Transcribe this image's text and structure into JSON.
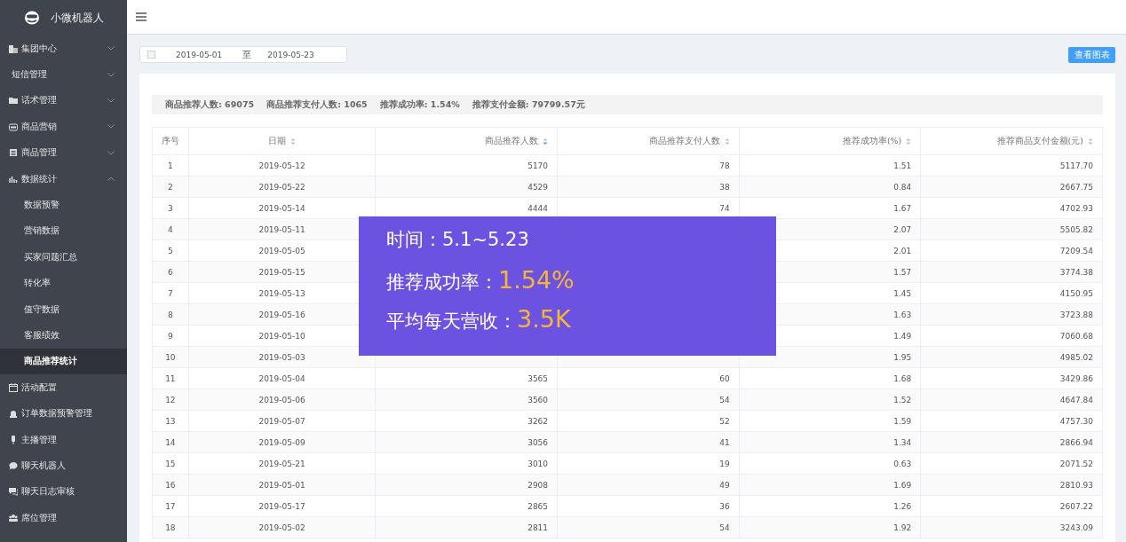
{
  "app": {
    "name": "小微机器人"
  },
  "sidebar": {
    "items": [
      {
        "label": "集团中心",
        "expanded": false
      },
      {
        "label": "短信管理",
        "expanded": false
      },
      {
        "label": "话术管理",
        "expanded": false
      },
      {
        "label": "商品营销",
        "expanded": false
      },
      {
        "label": "商品管理",
        "expanded": false
      },
      {
        "label": "数据统计",
        "expanded": true,
        "children": [
          {
            "label": "数据预警",
            "selected": false
          },
          {
            "label": "营销数据",
            "selected": false
          },
          {
            "label": "买家问题汇总",
            "selected": false
          },
          {
            "label": "转化率",
            "selected": false
          },
          {
            "label": "值守数据",
            "selected": false
          },
          {
            "label": "客服绩效",
            "selected": false
          },
          {
            "label": "商品推荐统计",
            "selected": true
          }
        ]
      },
      {
        "label": "活动配置"
      },
      {
        "label": "订单数据预警管理"
      },
      {
        "label": "主播管理"
      },
      {
        "label": "聊天机器人"
      },
      {
        "label": "聊天日志审核"
      },
      {
        "label": "席位管理"
      }
    ]
  },
  "filter": {
    "start": "2019-05-01",
    "separator": "至",
    "end": "2019-05-23"
  },
  "chart_button": "查看图表",
  "summary": [
    "商品推荐人数: 69075",
    "商品推荐支付人数: 1065",
    "推荐成功率: 1.54%",
    "推荐支付金额: 79799.57元"
  ],
  "table": {
    "columns": [
      {
        "label": "序号",
        "sortable": false
      },
      {
        "label": "日期",
        "sortable": true,
        "sorted": false
      },
      {
        "label": "商品推荐人数",
        "sortable": true,
        "sorted": true
      },
      {
        "label": "商品推荐支付人数",
        "sortable": true,
        "sorted": false
      },
      {
        "label": "推荐成功率(%)",
        "sortable": true,
        "sorted": false
      },
      {
        "label": "推荐商品支付金额(元)",
        "sortable": true,
        "sorted": false
      }
    ],
    "rows": [
      [
        "1",
        "2019-05-12",
        "5170",
        "78",
        "1.51",
        "5117.70"
      ],
      [
        "2",
        "2019-05-22",
        "4529",
        "38",
        "0.84",
        "2667.75"
      ],
      [
        "3",
        "2019-05-14",
        "4444",
        "74",
        "1.67",
        "4702.93"
      ],
      [
        "4",
        "2019-05-11",
        null,
        null,
        "2.07",
        "5505.82"
      ],
      [
        "5",
        "2019-05-05",
        null,
        null,
        "2.01",
        "7209.54"
      ],
      [
        "6",
        "2019-05-15",
        null,
        null,
        "1.57",
        "3774.38"
      ],
      [
        "7",
        "2019-05-13",
        null,
        null,
        "1.45",
        "4150.95"
      ],
      [
        "8",
        "2019-05-16",
        null,
        null,
        "1.63",
        "3723.88"
      ],
      [
        "9",
        "2019-05-10",
        null,
        null,
        "1.49",
        "7060.68"
      ],
      [
        "10",
        "2019-05-03",
        null,
        null,
        "1.95",
        "4985.02"
      ],
      [
        "11",
        "2019-05-04",
        "3565",
        "60",
        "1.68",
        "3429.86"
      ],
      [
        "12",
        "2019-05-06",
        "3560",
        "54",
        "1.52",
        "4647.84"
      ],
      [
        "13",
        "2019-05-07",
        "3262",
        "52",
        "1.59",
        "4757.30"
      ],
      [
        "14",
        "2019-05-09",
        "3056",
        "41",
        "1.34",
        "2866.94"
      ],
      [
        "15",
        "2019-05-21",
        "3010",
        "19",
        "0.63",
        "2071.52"
      ],
      [
        "16",
        "2019-05-01",
        "2908",
        "49",
        "1.69",
        "2810.93"
      ],
      [
        "17",
        "2019-05-17",
        "2865",
        "36",
        "1.26",
        "2607.22"
      ],
      [
        "18",
        "2019-05-02",
        "2811",
        "54",
        "1.92",
        "3243.09"
      ]
    ]
  },
  "overlay": {
    "lines": [
      {
        "label": "时间：",
        "value": "5.1~5.23",
        "highlight": false
      },
      {
        "label": "推荐成功率：",
        "value": "1.54%",
        "highlight": true
      },
      {
        "label": "平均每天营收：",
        "value": "3.5K",
        "highlight": true
      }
    ]
  }
}
